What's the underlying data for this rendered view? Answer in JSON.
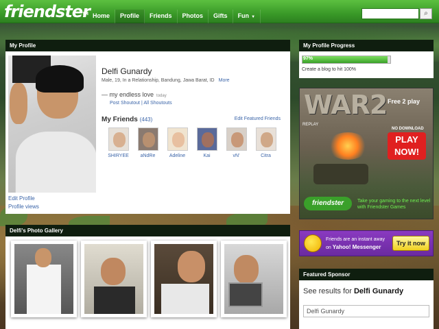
{
  "header": {
    "logo": "friendster",
    "nav": [
      {
        "label": "Home"
      },
      {
        "label": "Profile"
      },
      {
        "label": "Friends"
      },
      {
        "label": "Photos"
      },
      {
        "label": "Gifts"
      },
      {
        "label": "Fun"
      }
    ],
    "search_icon": "magnifier-icon"
  },
  "profile": {
    "panel_title": "My Profile",
    "name": "Delfi Gunardy",
    "info": "Male, 19, In a Relationship, Bandung, Jawa Barat, ID",
    "more": "More",
    "shoutout": "my endless love",
    "shoutout_time": "today",
    "post_shoutout": "Post Shoutout",
    "all_shoutouts": "All Shoutouts",
    "edit_profile": "Edit Profile",
    "profile_views": "Profile views",
    "friends_title": "My Friends",
    "friends_count": "(443)",
    "edit_friends": "Edit Featured Friends",
    "friends": [
      {
        "name": "SHIRYEE"
      },
      {
        "name": "aNdRe"
      },
      {
        "name": "Adeline"
      },
      {
        "name": "Kai"
      },
      {
        "name": "vN'"
      },
      {
        "name": "Citra"
      }
    ]
  },
  "gallery": {
    "panel_title": "Delfi's Photo Gallery"
  },
  "progress": {
    "panel_title": "My Profile Progress",
    "value": 0.97,
    "label": "97%",
    "note": "Create a blog to hit 100%"
  },
  "ad": {
    "title": "WAR2",
    "free2play": "Free 2 play",
    "replay": "REPLAY",
    "no_download": "NO DOWNLOAD",
    "play": "PLAY NOW!",
    "brand": "friendster",
    "tagline": "Take your gaming to the next level with Friendster Games"
  },
  "messenger": {
    "line1": "Friends are an instant away",
    "line2_prefix": "on",
    "line2_brand": "Yahoo! Messenger",
    "button": "Try it now"
  },
  "sponsor": {
    "panel_title": "Featured Sponsor",
    "results_prefix": "See results for",
    "results_name": "Delfi Gunardy",
    "query": "Delfi Gunardy"
  },
  "colors": {
    "brand_green": "#3a9a28",
    "panel_dark": "#0f1e0f",
    "link_blue": "#3a64a8"
  }
}
